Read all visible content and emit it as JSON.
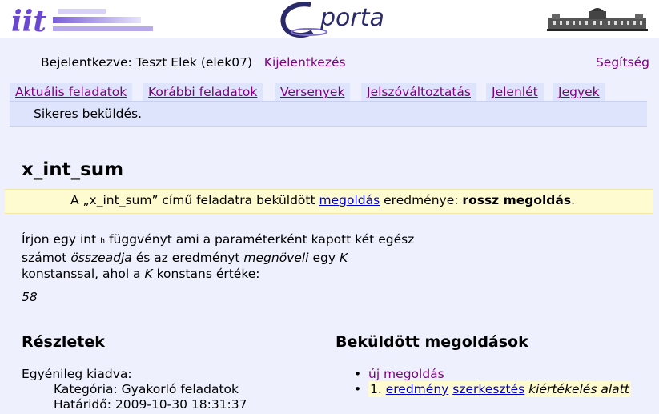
{
  "header": {
    "logo_left": "iit",
    "logo_center": "Cporta",
    "logo_right_icon": "university-building-icon"
  },
  "login": {
    "prefix": "Bejelentkezve: Teszt Elek (elek07)",
    "logout_label": "Kijelentkezés",
    "help_label": "Segítség"
  },
  "nav": {
    "items": [
      {
        "label": "Aktuális feladatok"
      },
      {
        "label": "Korábbi feladatok"
      },
      {
        "label": "Versenyek"
      },
      {
        "label": "Jelszóváltoztatás"
      },
      {
        "label": "Jelenlét"
      },
      {
        "label": "Jegyek"
      }
    ]
  },
  "status_message": "Sikeres beküldés.",
  "task": {
    "title": "x_int_sum",
    "result": {
      "prefix": "A „x_int_sum” című feladatra beküldött",
      "link": "megoldás",
      "middle": "eredménye:",
      "verdict": "rossz megoldás",
      "suffix": "."
    },
    "description": {
      "p1": "Írjon egy int",
      "p1_code": "h",
      "p2": "függvényt ami a paraméterként kapott két egész",
      "p3": "számot",
      "p3_em": "összeadja",
      "p4": "és az eredményt",
      "p4_em": "megnöveli",
      "p5": "egy",
      "p5_em": "K",
      "p6": "konstanssal, ahol a",
      "p6_em": "K",
      "p7": "konstans értéke:"
    },
    "constant_value": "58"
  },
  "details": {
    "heading": "Részletek",
    "assigned": "Egyénileg kiadva:",
    "category": "Kategória: Gyakorló feladatok",
    "deadline": "Határidő: 2009-10-30 18:31:37"
  },
  "submissions": {
    "heading": "Beküldött megoldások",
    "new_label": "új megoldás",
    "entry_index": "1.",
    "result_link": "eredmény",
    "edit_link": "szerkesztés",
    "state": "kiértékelés alatt"
  },
  "colors": {
    "page_bg": "#eef1fd",
    "nav_bg": "#dde4fb",
    "link_purple": "#800080",
    "link_blue": "#0000cc",
    "highlight_yellow": "#fffbd0"
  }
}
